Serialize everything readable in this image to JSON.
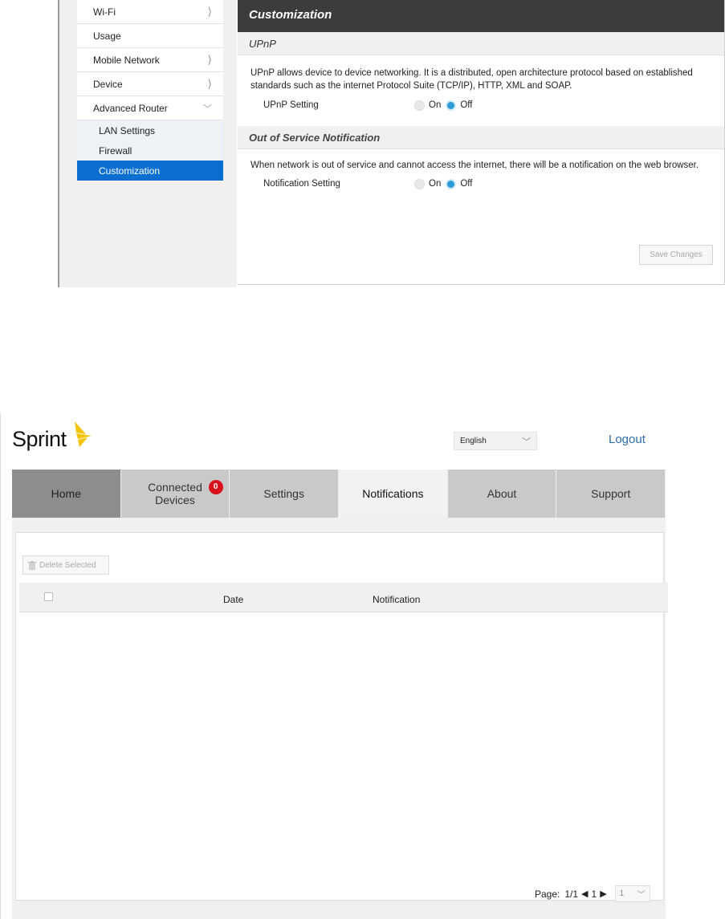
{
  "router": {
    "nav": [
      {
        "label": "Wi-Fi",
        "icon": "chevron-right-icon"
      },
      {
        "label": "Usage",
        "icon": ""
      },
      {
        "label": "Mobile Network",
        "icon": "chevron-right-icon"
      },
      {
        "label": "Device",
        "icon": "chevron-right-icon"
      },
      {
        "label": "Advanced Router",
        "icon": "chevron-down-icon"
      }
    ],
    "subnav": [
      "LAN Settings",
      "Firewall",
      "Customization"
    ],
    "active_subnav": "Customization",
    "panel_title": "Customization",
    "upnp": {
      "heading": "UPnP",
      "description": "UPnP allows device to device networking. It is a distributed, open architecture protocol based on established standards such as the internet Protocol Suite (TCP/IP), HTTP, XML and SOAP.",
      "setting_label": "UPnP Setting",
      "on_label": "On",
      "off_label": "Off",
      "selected": "Off"
    },
    "oos": {
      "heading": "Out of Service Notification",
      "description": "When network is out of service and cannot access the internet, there will be a notification on the web browser.",
      "setting_label": "Notification Setting",
      "on_label": "On",
      "off_label": "Off",
      "selected": "Off"
    },
    "save_label": "Save Changes"
  },
  "notifications_page": {
    "logo_text": "Sprint",
    "language": "English",
    "logout_label": "Logout",
    "tabs": [
      {
        "label": "Home"
      },
      {
        "label": "Connected Devices",
        "line1": "Connected",
        "line2": "Devices",
        "badge": "0"
      },
      {
        "label": "Settings"
      },
      {
        "label": "Notifications"
      },
      {
        "label": "About"
      },
      {
        "label": "Support"
      }
    ],
    "selected_tab": "Notifications",
    "delete_label": "Delete Selected",
    "columns": [
      "Date",
      "Notification"
    ],
    "pager": {
      "label": "Page:",
      "current_of_total": "1/1",
      "page": "1",
      "select_value": "1"
    },
    "colors": {
      "accent_blue": "#0b6fd1",
      "logo_yellow": "#f5c400",
      "badge_red": "#d8111c",
      "link_blue": "#2d6da8"
    }
  }
}
